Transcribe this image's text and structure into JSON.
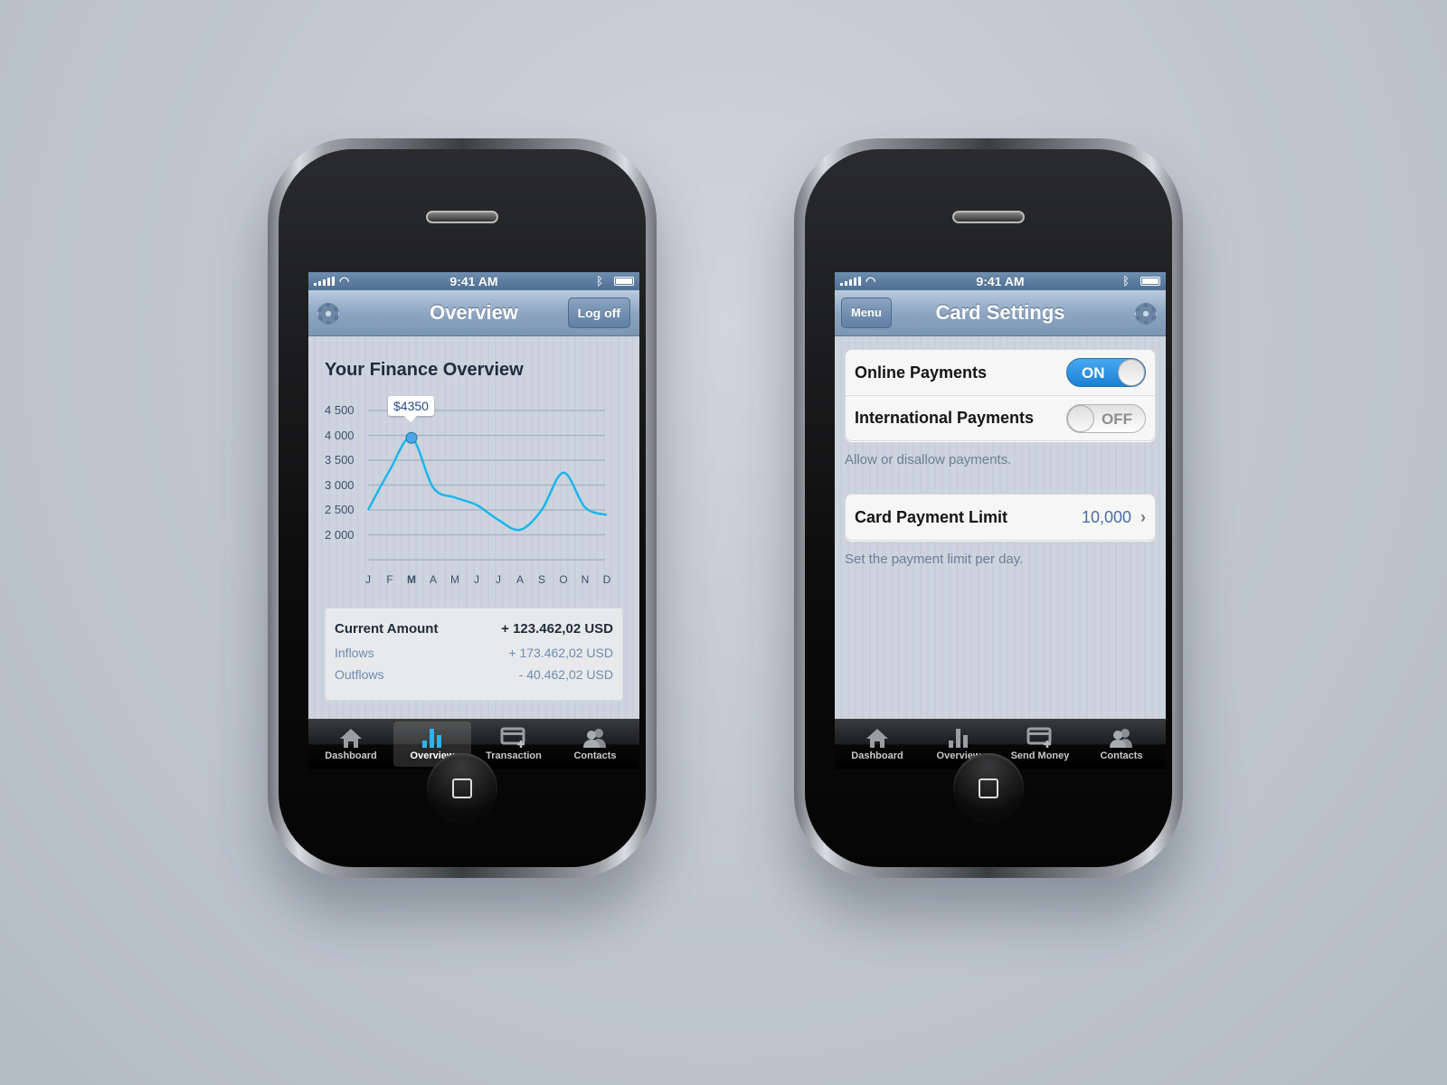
{
  "status_bar": {
    "time": "9:41 AM"
  },
  "overview_screen": {
    "title": "Overview",
    "logoff_label": "Log off",
    "heading": "Your Finance Overview",
    "tooltip": "$4350",
    "summary": {
      "current_label": "Current Amount",
      "current_value": "+ 123.462,02 USD",
      "inflows_label": "Inflows",
      "inflows_value": "+ 173.462,02 USD",
      "outflows_label": "Outflows",
      "outflows_value": "- 40.462,02 USD"
    },
    "tabs": [
      {
        "label": "Dashboard",
        "icon": "home-icon"
      },
      {
        "label": "Overview",
        "icon": "bar-chart-icon",
        "active": true
      },
      {
        "label": "Transaction",
        "icon": "card-add-icon"
      },
      {
        "label": "Contacts",
        "icon": "contacts-icon"
      }
    ]
  },
  "chart_data": {
    "type": "line",
    "categories": [
      "J",
      "F",
      "M",
      "A",
      "M",
      "J",
      "J",
      "A",
      "S",
      "O",
      "N",
      "D"
    ],
    "y_ticks": [
      "4 500",
      "4 000",
      "3 500",
      "3 000",
      "2 500",
      "2 000"
    ],
    "ylim": [
      1500,
      4500
    ],
    "values": [
      2500,
      3300,
      3950,
      2950,
      2750,
      2600,
      2300,
      2100,
      2500,
      3250,
      2550,
      2400
    ],
    "highlight_index": 2,
    "line_color": "#19b6ec",
    "grid": true
  },
  "settings_screen": {
    "title": "Card Settings",
    "menu_label": "Menu",
    "online_label": "Online Payments",
    "online_state": "ON",
    "intl_label": "International Payments",
    "intl_state": "OFF",
    "payments_note": "Allow or disallow payments.",
    "limit_label": "Card Payment Limit",
    "limit_value": "10,000",
    "limit_note": "Set the payment limit per day.",
    "tabs": [
      {
        "label": "Dashboard",
        "icon": "home-icon"
      },
      {
        "label": "Overview",
        "icon": "bar-chart-icon"
      },
      {
        "label": "Send Money",
        "icon": "card-add-icon"
      },
      {
        "label": "Contacts",
        "icon": "contacts-icon"
      }
    ]
  }
}
